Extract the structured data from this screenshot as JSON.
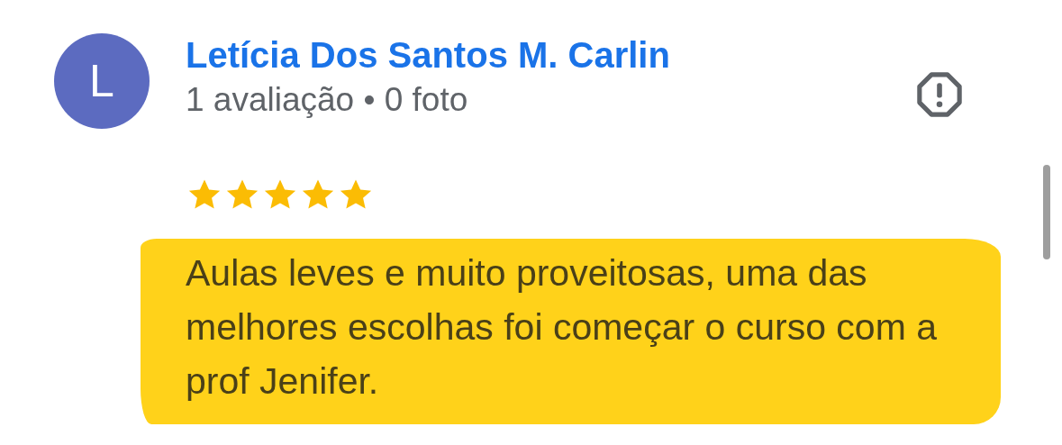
{
  "review": {
    "author": {
      "initial": "L",
      "name": "Letícia Dos Santos M. Carlin",
      "meta": "1 avaliação • 0 foto"
    },
    "stars": 5,
    "text": "Aulas leves e muito proveitosas, uma das melhores escolhas foi começar o curso com a prof Jenifer."
  }
}
